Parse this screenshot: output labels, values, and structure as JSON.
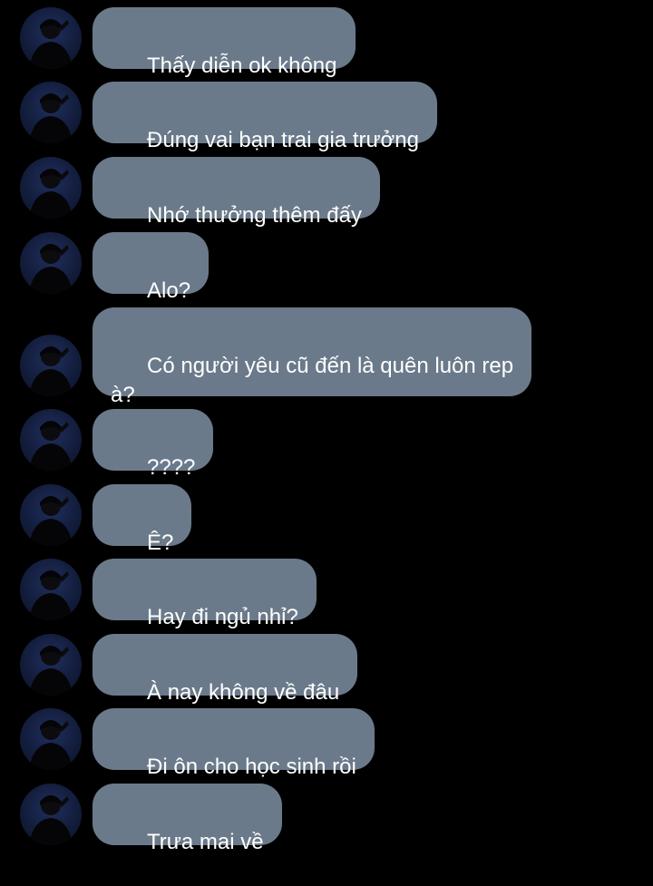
{
  "messages": [
    {
      "text": "Thấy diễn ok không"
    },
    {
      "text": "Đúng vai bạn trai gia trưởng"
    },
    {
      "text": "Nhớ thưởng thêm đấy"
    },
    {
      "text": "Alo?"
    },
    {
      "text": "Có người yêu cũ đến là quên luôn rep\nà?"
    },
    {
      "text": "????"
    },
    {
      "text": "Ê?"
    },
    {
      "text": "Hay đi ngủ nhỉ?"
    },
    {
      "text": "À nay không về đâu"
    },
    {
      "text": "Đi ôn cho học sinh rồi"
    },
    {
      "text": "Trưa mai về"
    }
  ],
  "colors": {
    "background": "#000000",
    "bubble": "#6b7a8a",
    "text": "#ffffff"
  },
  "icons": {
    "avatar": "user-avatar-photo"
  }
}
